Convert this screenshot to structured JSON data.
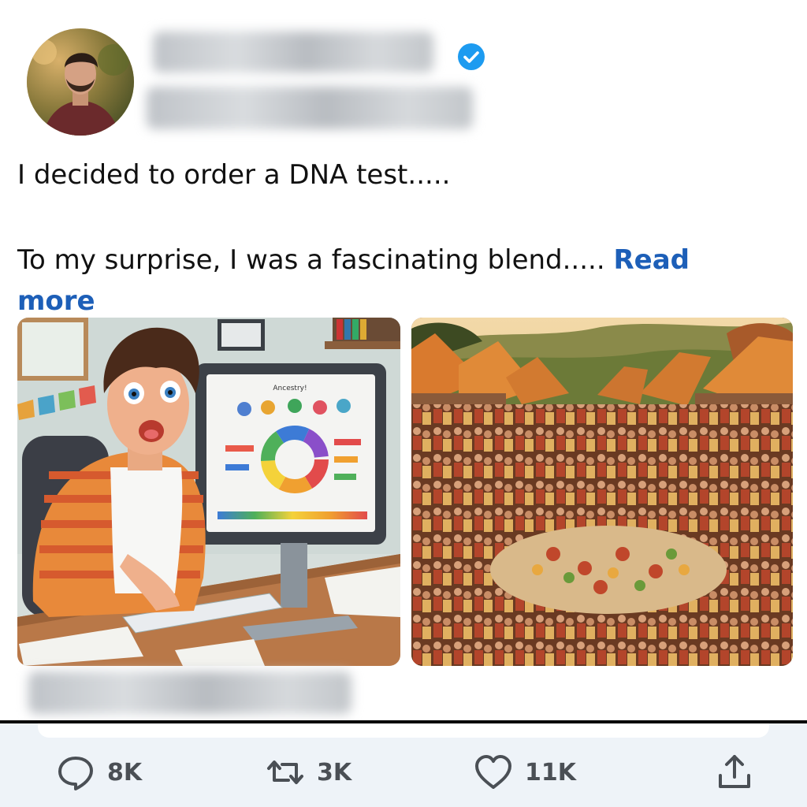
{
  "post": {
    "line1": "I decided to order a DNA test.....",
    "line2": "To my surprise, I was a fascinating blend..... ",
    "read_more": "Read more"
  },
  "image_left": {
    "screen_title": "Ancestry!"
  },
  "actions": {
    "replies": "8K",
    "reposts": "3K",
    "likes": "11K"
  },
  "colors": {
    "verified": "#1d9bf0",
    "link": "#1d5fb8",
    "action_bar": "#eef3f8"
  },
  "icons": [
    "verified-badge-icon",
    "reply-icon",
    "repost-icon",
    "like-icon",
    "share-icon"
  ]
}
